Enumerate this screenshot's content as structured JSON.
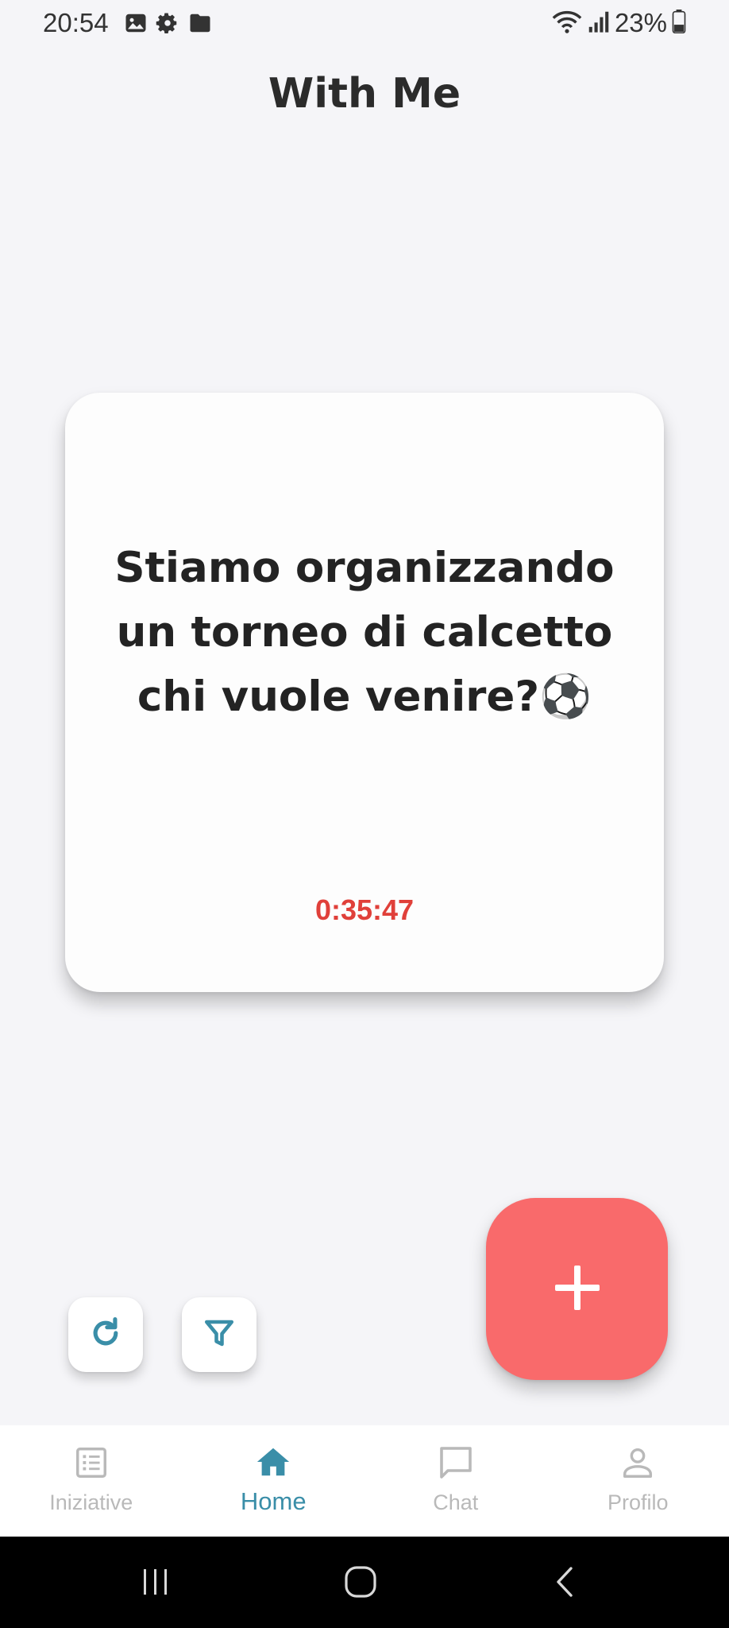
{
  "status_bar": {
    "time": "20:54",
    "battery": "23%"
  },
  "app": {
    "title": "With Me"
  },
  "card": {
    "message": "Stiamo organizzando un torneo di calcetto chi vuole venire?⚽",
    "timer": "0:35:47"
  },
  "actions": {
    "refresh_icon": "refresh-icon",
    "filter_icon": "filter-icon",
    "add_icon": "plus-icon"
  },
  "bottom_nav": {
    "items": [
      {
        "label": "Iniziative",
        "icon": "list-icon",
        "active": false
      },
      {
        "label": "Home",
        "icon": "home-icon",
        "active": true
      },
      {
        "label": "Chat",
        "icon": "chat-icon",
        "active": false
      },
      {
        "label": "Profilo",
        "icon": "person-icon",
        "active": false
      }
    ]
  },
  "colors": {
    "accent": "#3a8ea8",
    "fab": "#f96a6b",
    "timer": "#e0403a",
    "inactive": "#b9b9b9"
  }
}
